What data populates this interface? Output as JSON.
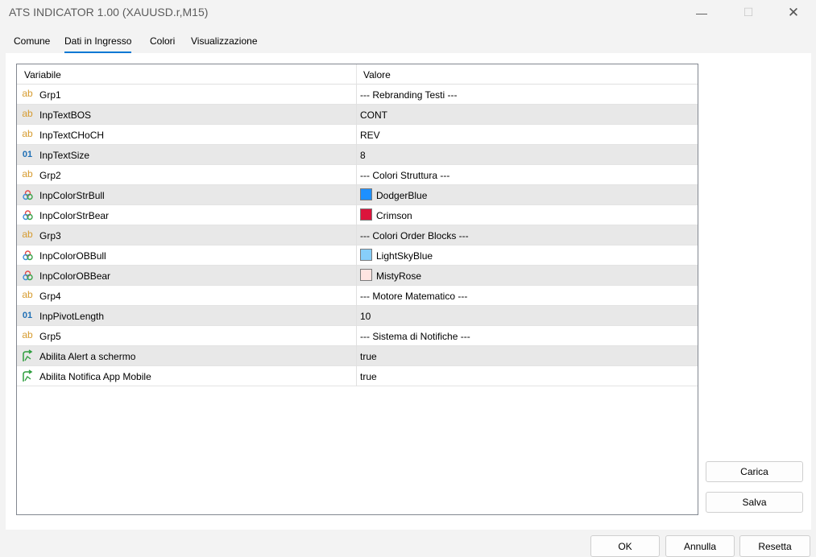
{
  "window": {
    "title": "ATS INDICATOR 1.00 (XAUUSD.r,M15)",
    "minimize_glyph": "—",
    "maximize_glyph": "☐",
    "close_glyph": "✕"
  },
  "tabs": [
    {
      "label": "Comune",
      "active": false
    },
    {
      "label": "Dati in Ingresso",
      "active": true
    },
    {
      "label": "Colori",
      "active": false
    },
    {
      "label": "Visualizzazione",
      "active": false
    }
  ],
  "grid": {
    "col_variable": "Variabile",
    "col_value": "Valore",
    "rows": [
      {
        "icon": "text-icon",
        "name": "Grp1",
        "value": "--- Rebranding Testi ---"
      },
      {
        "icon": "text-icon",
        "name": "InpTextBOS",
        "value": "CONT"
      },
      {
        "icon": "text-icon",
        "name": "InpTextCHoCH",
        "value": "REV"
      },
      {
        "icon": "integer-icon",
        "name": "InpTextSize",
        "value": "8"
      },
      {
        "icon": "text-icon",
        "name": "Grp2",
        "value": "--- Colori Struttura ---"
      },
      {
        "icon": "color-icon",
        "name": "InpColorStrBull",
        "value": "DodgerBlue",
        "color": "#1e90ff"
      },
      {
        "icon": "color-icon",
        "name": "InpColorStrBear",
        "value": "Crimson",
        "color": "#dc143c"
      },
      {
        "icon": "text-icon",
        "name": "Grp3",
        "value": "--- Colori Order Blocks ---"
      },
      {
        "icon": "color-icon",
        "name": "InpColorOBBull",
        "value": "LightSkyBlue",
        "color": "#87cefa"
      },
      {
        "icon": "color-icon",
        "name": "InpColorOBBear",
        "value": "MistyRose",
        "color": "#ffe4e1"
      },
      {
        "icon": "text-icon",
        "name": "Grp4",
        "value": "--- Motore Matematico ---"
      },
      {
        "icon": "integer-icon",
        "name": "InpPivotLength",
        "value": "10"
      },
      {
        "icon": "text-icon",
        "name": "Grp5",
        "value": "--- Sistema di Notifiche ---"
      },
      {
        "icon": "bool-icon",
        "name": "Abilita Alert a schermo",
        "value": "true"
      },
      {
        "icon": "bool-icon",
        "name": "Abilita Notifica App Mobile",
        "value": "true"
      }
    ]
  },
  "side_buttons": {
    "load": "Carica",
    "save": "Salva"
  },
  "footer_buttons": {
    "ok": "OK",
    "cancel": "Annulla",
    "reset": "Resetta"
  },
  "icon_glyphs": {
    "text": "ab",
    "integer": "01"
  }
}
